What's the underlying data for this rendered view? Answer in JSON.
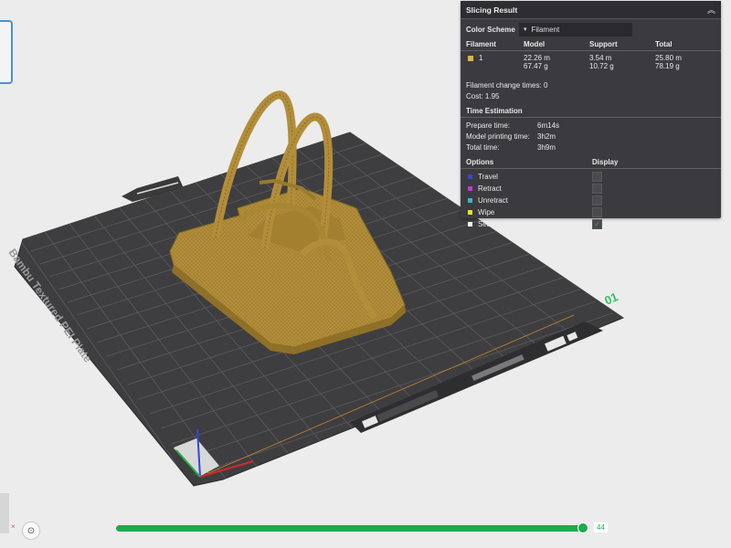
{
  "panel": {
    "title": "Slicing Result",
    "collapse_icon": "chevron-up-icon",
    "color_scheme_label": "Color Scheme",
    "color_scheme_value": "Filament",
    "columns": [
      "Filament",
      "Model",
      "Support",
      "Total"
    ],
    "filament_row": {
      "id": "1",
      "swatch_color": "#d9b44a",
      "model_len": "22.26 m",
      "model_wt": "67.47 g",
      "support_len": "3.54 m",
      "support_wt": "10.72 g",
      "total_len": "25.80 m",
      "total_wt": "78.19 g"
    },
    "change_label": "Filament change times:",
    "change_value": "0",
    "cost_label": "Cost:",
    "cost_value": "1.95",
    "time_title": "Time Estimation",
    "prepare_label": "Prepare time:",
    "prepare_value": "6m14s",
    "model_label": "Model printing time:",
    "model_value": "3h2m",
    "total_label": "Total time:",
    "total_value": "3h9m",
    "options_label": "Options",
    "display_label": "Display",
    "options": [
      {
        "name": "Travel",
        "color": "#3a45d6",
        "checked": false
      },
      {
        "name": "Retract",
        "color": "#c23ad0",
        "checked": false
      },
      {
        "name": "Unretract",
        "color": "#3ab5c8",
        "checked": false
      },
      {
        "name": "Wipe",
        "color": "#e8e02a",
        "checked": false
      },
      {
        "name": "Seams",
        "color": "#f0f0f0",
        "checked": true
      }
    ]
  },
  "plate": {
    "label": "Bambu Textured PEI Plate",
    "number": "01",
    "model_color": "#b28d3a"
  },
  "bottom": {
    "layer_value": "44",
    "layer_progress": 1.0,
    "fit_icon": "zoom-fit-icon"
  }
}
